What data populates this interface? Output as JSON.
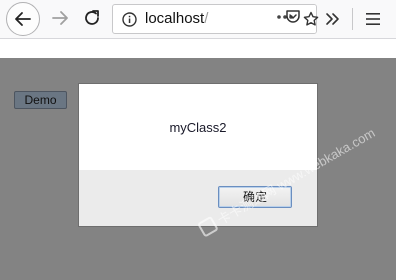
{
  "browser": {
    "url_host": "localhost",
    "url_path": "/",
    "icons": [
      "back-arrow-icon",
      "forward-arrow-icon",
      "reload-icon",
      "info-icon",
      "page-actions-icon",
      "pocket-icon",
      "bookmark-star-icon",
      "overflow-icon",
      "hamburger-menu-icon"
    ]
  },
  "page": {
    "demo_button_label": "Demo"
  },
  "dialog": {
    "message": "myClass2",
    "ok_label": "确定"
  },
  "watermark": {
    "text": "卡卡测速网 www.webkaka.com"
  },
  "colors": {
    "overlay": "#838383",
    "demo_button_bg": "#6a7683",
    "dialog_footer_bg": "#ebebeb",
    "ok_button_border": "#6a8ec0"
  }
}
